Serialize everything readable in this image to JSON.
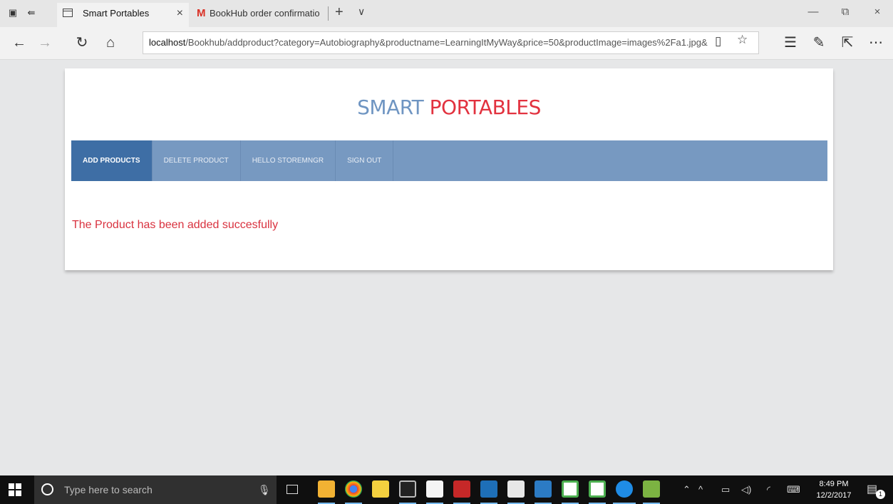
{
  "browser": {
    "tabs": [
      {
        "label": "Smart Portables",
        "close": "×"
      },
      {
        "label": "BookHub order confirmatio",
        "icon_letter": "M"
      }
    ],
    "new_tab": "+",
    "tab_menu": "∨",
    "window_controls": {
      "minimize": "—",
      "restore": "⧉",
      "close": "×"
    },
    "address": {
      "host": "localhost",
      "path": "/Bookhub/addproduct?category=Autobiography&productname=LearningItMyWay&price=50&productImage=images%2Fa1.jpg&"
    }
  },
  "page": {
    "logo_part1": "SMART",
    "logo_part2": "PORTABLES",
    "menu": [
      {
        "label": "ADD PRODUCTS",
        "active": true
      },
      {
        "label": "DELETE PRODUCT",
        "active": false
      },
      {
        "label": "HELLO STOREMNGR",
        "active": false
      },
      {
        "label": "SIGN OUT",
        "active": false
      }
    ],
    "message": "The Product has been added succesfully"
  },
  "taskbar": {
    "search_placeholder": "Type here to search",
    "time": "8:49 PM",
    "date": "12/2/2017",
    "notification_count": "1"
  },
  "colors": {
    "logo_blue": "#6f95c2",
    "logo_red": "#e2323f",
    "menu_bg": "#7799c1",
    "menu_active": "#3e6ea5",
    "message": "#d9323f"
  }
}
